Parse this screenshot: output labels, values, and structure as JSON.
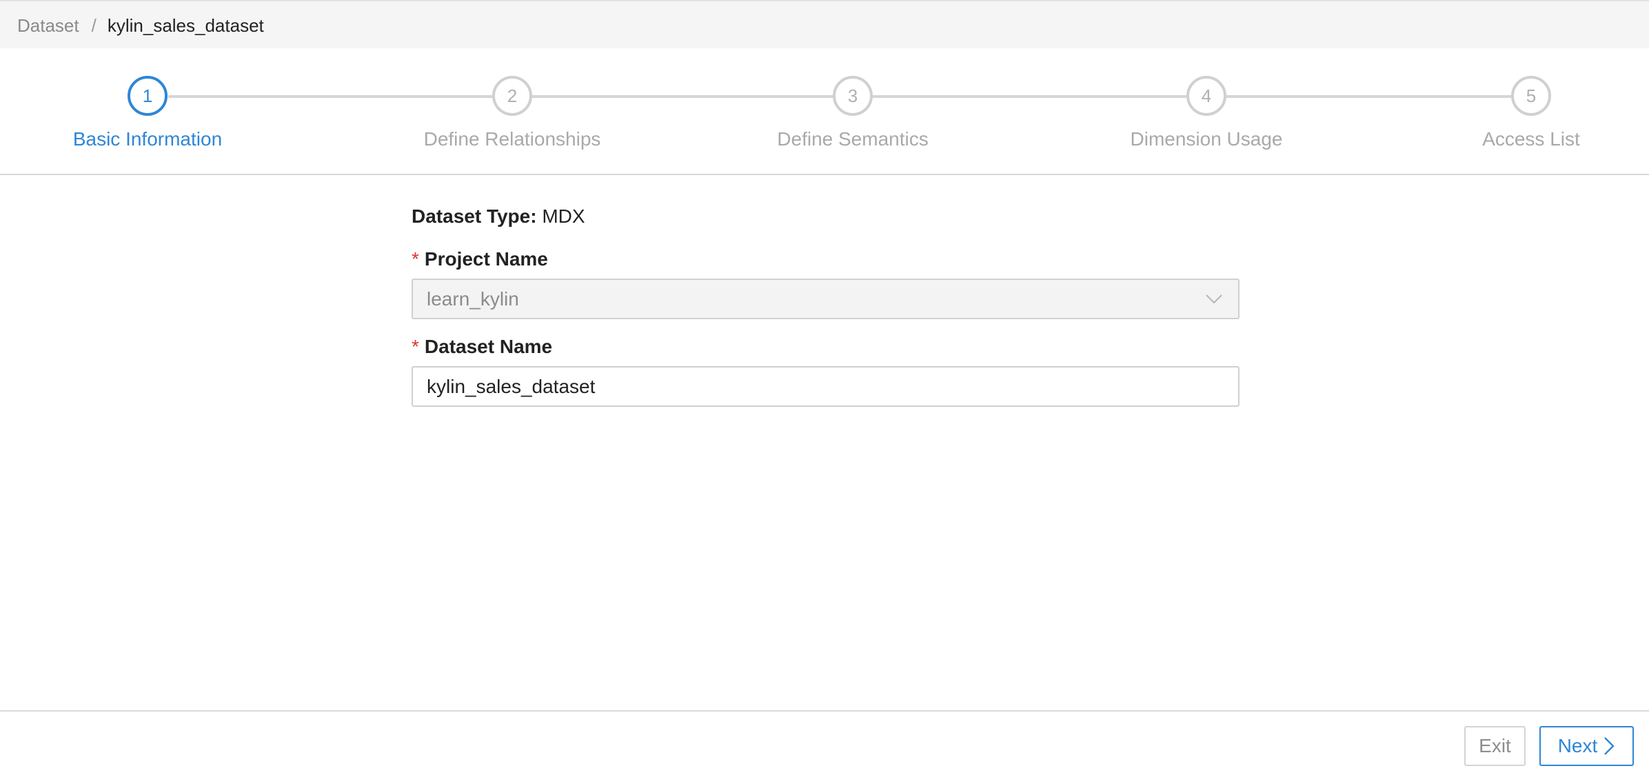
{
  "breadcrumb": {
    "root": "Dataset",
    "separator": "/",
    "current": "kylin_sales_dataset"
  },
  "steps": [
    {
      "number": "1",
      "label": "Basic Information",
      "active": true
    },
    {
      "number": "2",
      "label": "Define Relationships",
      "active": false
    },
    {
      "number": "3",
      "label": "Define Semantics",
      "active": false
    },
    {
      "number": "4",
      "label": "Dimension Usage",
      "active": false
    },
    {
      "number": "5",
      "label": "Access List",
      "active": false
    }
  ],
  "form": {
    "dataset_type_label": "Dataset Type:",
    "dataset_type_value": "MDX",
    "required_mark": "*",
    "project_name_label": "Project Name",
    "project_name_value": "learn_kylin",
    "dataset_name_label": "Dataset Name",
    "dataset_name_value": "kylin_sales_dataset"
  },
  "footer": {
    "exit_label": "Exit",
    "next_label": "Next"
  },
  "colors": {
    "accent": "#2f86d6",
    "inactive": "#a9a9a9",
    "required": "#e0342f",
    "topbar_bg": "#f5f5f5"
  },
  "icons": {
    "select_chevron": "chevron-down-icon",
    "next_arrow": "chevron-right-icon"
  }
}
